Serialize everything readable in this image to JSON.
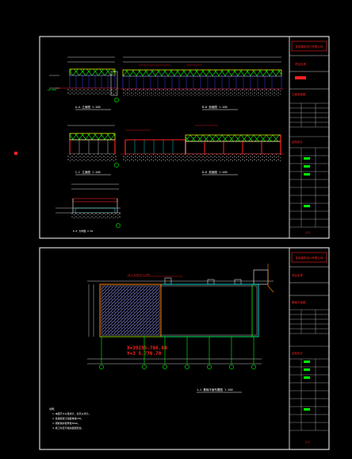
{
  "sheet1": {
    "upper_elevation_title": "A—A 立面图 1:100",
    "section_title": "B—B 剖面图 1:100",
    "lower_left_title": "C—C 立面图 1:100",
    "lower_right_title": "D—D 剖面图 1:100",
    "detail_title": "E—E 大样图 1:50",
    "elev_label_top": "±0.000",
    "grid_label": "1",
    "title_block": {
      "company": "某某建筑设计有限公司",
      "project": "项目名称",
      "drawing_name": "立面剖面图",
      "sheet": "1/2"
    }
  },
  "sheet2": {
    "plan_title": "1—1 基础平面布置图 1:100",
    "coord_1": "X=39235.766.84",
    "coord_2": "Y=3 5.770.70",
    "grid_labels": [
      "1",
      "2",
      "3",
      "4",
      "5",
      "6",
      "7",
      "8"
    ],
    "notes": [
      "说明：",
      "1.本图尺寸以毫米计，标高以米计。",
      "2.基础混凝土强度等级C30。",
      "3.钢筋保护层厚度40mm。",
      "4.施工时应与相关图纸配合。"
    ],
    "title_block": {
      "company": "某某建筑设计有限公司",
      "project": "项目名称",
      "drawing_name": "基础平面图",
      "sheet": "2/2"
    }
  },
  "colors": {
    "frame": "#ffffff",
    "red": "#ff2020",
    "yellow": "#ffff00",
    "green": "#00ff00",
    "cyan": "#00ffff",
    "blue": "#3a3aff",
    "magenta": "#ff00ff",
    "orange": "#ff8000"
  }
}
